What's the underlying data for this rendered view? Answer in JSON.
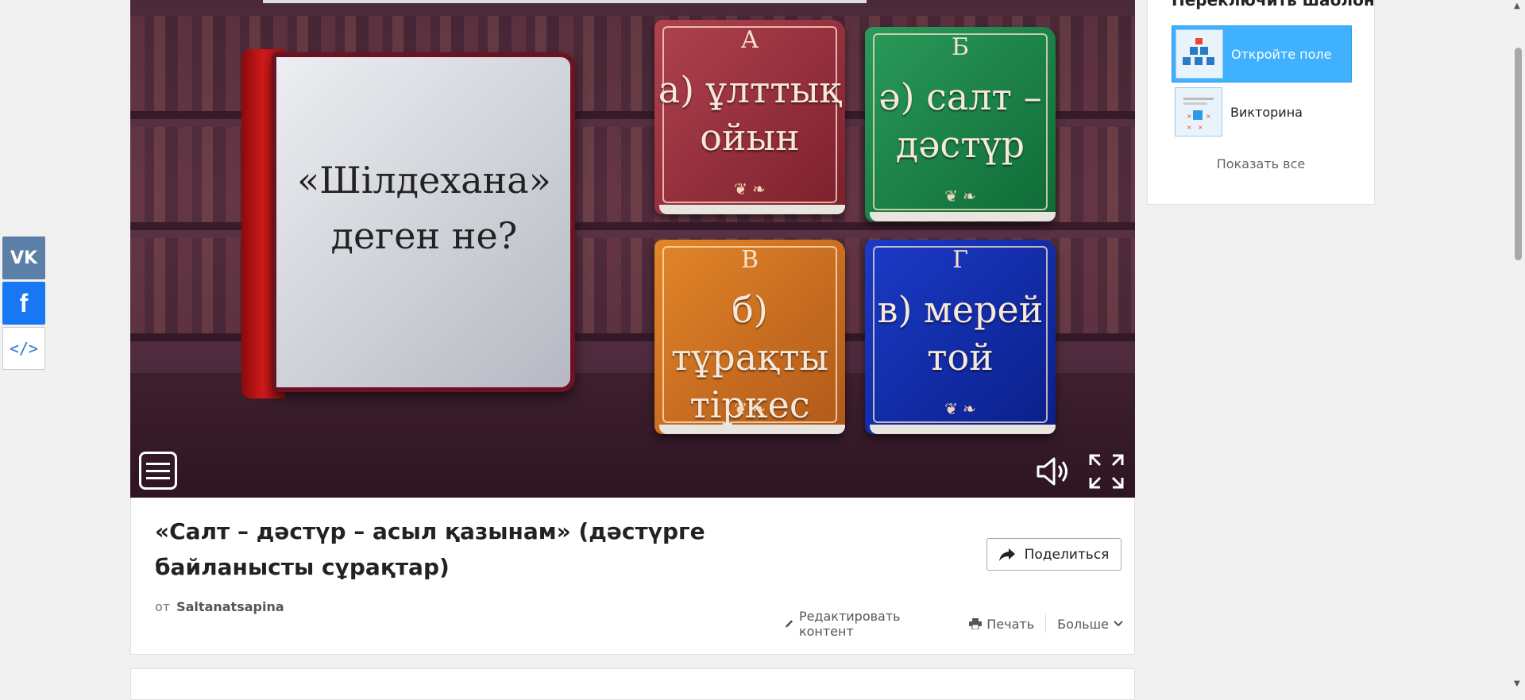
{
  "share_bar": {
    "vk": "VK",
    "facebook": "f",
    "embed": "</>"
  },
  "game": {
    "question": "«Шілдехана» деген не?",
    "answers": [
      {
        "letter": "А",
        "text": "а) ұлттық ойын",
        "color": "#9b3040"
      },
      {
        "letter": "Б",
        "text": "ә) салт – дәстүр",
        "color": "#1d8048"
      },
      {
        "letter": "В",
        "text": "б) тұрақты тіркес",
        "color": "#cc6d20"
      },
      {
        "letter": "Г",
        "text": "в) мерей той",
        "color": "#1330b0"
      }
    ]
  },
  "activity": {
    "title": "«Салт – дәстүр – асыл қазынам» (дәстүрге байланысты сұрақтар)",
    "by_prefix": "от",
    "author": "Saltanatsapina",
    "share_label": "Поделиться",
    "actions": {
      "edit": "Редактировать контент",
      "print": "Печать",
      "more": "Больше"
    }
  },
  "sidebar": {
    "heading": "Переключить шаблон",
    "templates": [
      {
        "label": "Откройте поле",
        "active": true
      },
      {
        "label": "Викторина",
        "active": false
      }
    ],
    "show_all": "Показать все"
  },
  "colors": {
    "accent": "#3fb1ff",
    "vk": "#5b7fa6",
    "facebook": "#1877f2"
  }
}
